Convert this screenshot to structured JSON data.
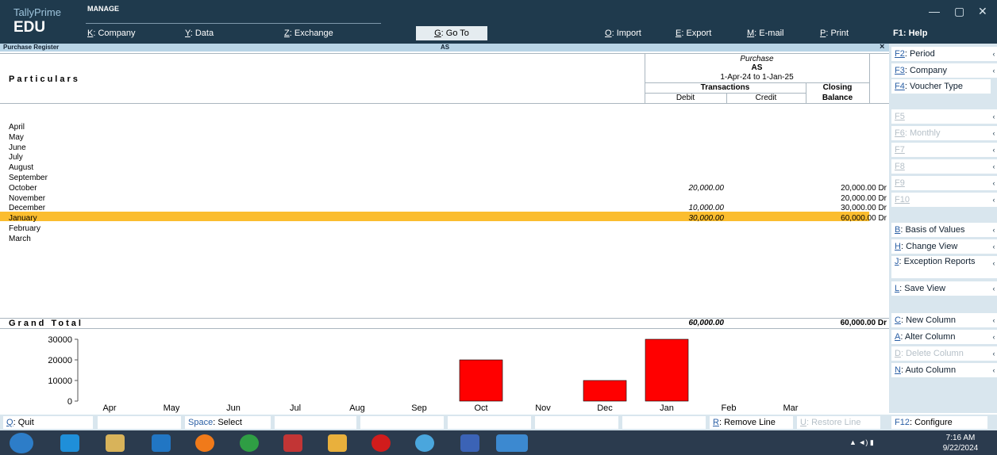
{
  "app": {
    "brand_line1": "TallyPrime",
    "brand_line2": "EDU",
    "manage_label": "MANAGE"
  },
  "menu": [
    {
      "key": "K",
      "label": "Company"
    },
    {
      "key": "Y",
      "label": "Data"
    },
    {
      "key": "Z",
      "label": "Exchange"
    },
    {
      "key": "G",
      "label": "Go To"
    },
    {
      "key": "O",
      "label": "Import"
    },
    {
      "key": "E",
      "label": "Export"
    },
    {
      "key": "M",
      "label": "E-mail"
    },
    {
      "key": "P",
      "label": "Print"
    },
    {
      "key": "F1",
      "label": "Help"
    }
  ],
  "subbar": {
    "title": "Purchase Register",
    "center": "AS",
    "close": "×"
  },
  "report": {
    "particulars_header": "Particulars",
    "col_title": "Purchase",
    "col_company": "AS",
    "col_period": "1-Apr-24 to 1-Jan-25",
    "transactions": "Transactions",
    "debit": "Debit",
    "credit": "Credit",
    "closing": "Closing",
    "balance": "Balance",
    "rows": [
      {
        "month": "April",
        "debit": "",
        "balance": ""
      },
      {
        "month": "May",
        "debit": "",
        "balance": ""
      },
      {
        "month": "June",
        "debit": "",
        "balance": ""
      },
      {
        "month": "July",
        "debit": "",
        "balance": ""
      },
      {
        "month": "August",
        "debit": "",
        "balance": ""
      },
      {
        "month": "September",
        "debit": "",
        "balance": ""
      },
      {
        "month": "October",
        "debit": "20,000.00",
        "balance": "20,000.00 Dr"
      },
      {
        "month": "November",
        "debit": "",
        "balance": "20,000.00 Dr"
      },
      {
        "month": "December",
        "debit": "10,000.00",
        "balance": "30,000.00 Dr"
      },
      {
        "month": "January",
        "debit": "30,000.00",
        "balance": "60,000.00 Dr"
      },
      {
        "month": "February",
        "debit": "",
        "balance": ""
      },
      {
        "month": "March",
        "debit": "",
        "balance": ""
      }
    ],
    "grand_total_label": "Grand Total",
    "grand_total_debit": "60,000.00",
    "grand_total_balance": "60,000.00 Dr"
  },
  "chart_data": {
    "type": "bar",
    "categories": [
      "Apr",
      "May",
      "Jun",
      "Jul",
      "Aug",
      "Sep",
      "Oct",
      "Nov",
      "Dec",
      "Jan",
      "Feb",
      "Mar"
    ],
    "values": [
      0,
      0,
      0,
      0,
      0,
      0,
      20000,
      0,
      10000,
      30000,
      0,
      0
    ],
    "yticks": [
      "0",
      "10000",
      "20000",
      "30000"
    ],
    "ylim": [
      0,
      30000
    ],
    "color": "#ff0000"
  },
  "right_panel": [
    {
      "key": "F2",
      "label": "Period",
      "enabled": true,
      "arrow": true
    },
    {
      "key": "F3",
      "label": "Company",
      "enabled": true,
      "arrow": true
    },
    {
      "key": "F4",
      "label": "Voucher Type",
      "enabled": true,
      "arrow": false
    },
    {
      "key": "F5",
      "label": "",
      "enabled": false,
      "arrow": true
    },
    {
      "key": "F6",
      "label": "Monthly",
      "enabled": false,
      "arrow": true
    },
    {
      "key": "F7",
      "label": "",
      "enabled": false,
      "arrow": true
    },
    {
      "key": "F8",
      "label": "",
      "enabled": false,
      "arrow": true
    },
    {
      "key": "F9",
      "label": "",
      "enabled": false,
      "arrow": true
    },
    {
      "key": "F10",
      "label": "",
      "enabled": false,
      "arrow": true
    },
    {
      "key": "B",
      "label": "Basis of Values",
      "enabled": true,
      "arrow": true
    },
    {
      "key": "H",
      "label": "Change View",
      "enabled": true,
      "arrow": true
    },
    {
      "key": "J",
      "label": "Exception Reports",
      "enabled": true,
      "arrow": true
    },
    {
      "key": "L",
      "label": "Save View",
      "enabled": true,
      "arrow": true
    },
    {
      "key": "C",
      "label": "New Column",
      "enabled": true,
      "arrow": true
    },
    {
      "key": "A",
      "label": "Alter Column",
      "enabled": true,
      "arrow": true
    },
    {
      "key": "D",
      "label": "Delete Column",
      "enabled": false,
      "arrow": true
    },
    {
      "key": "N",
      "label": "Auto Column",
      "enabled": true,
      "arrow": true
    }
  ],
  "bottom_bar": [
    {
      "key": "Q",
      "label": "Quit"
    },
    {
      "key": "Space",
      "label": "Select"
    },
    {
      "key": "R",
      "label": "Remove Line"
    },
    {
      "key": "U",
      "label": "Restore Line"
    },
    {
      "key": "F12",
      "label": "Configure"
    }
  ],
  "taskbar": {
    "time": "7:16 AM",
    "date": "9/22/2024"
  }
}
